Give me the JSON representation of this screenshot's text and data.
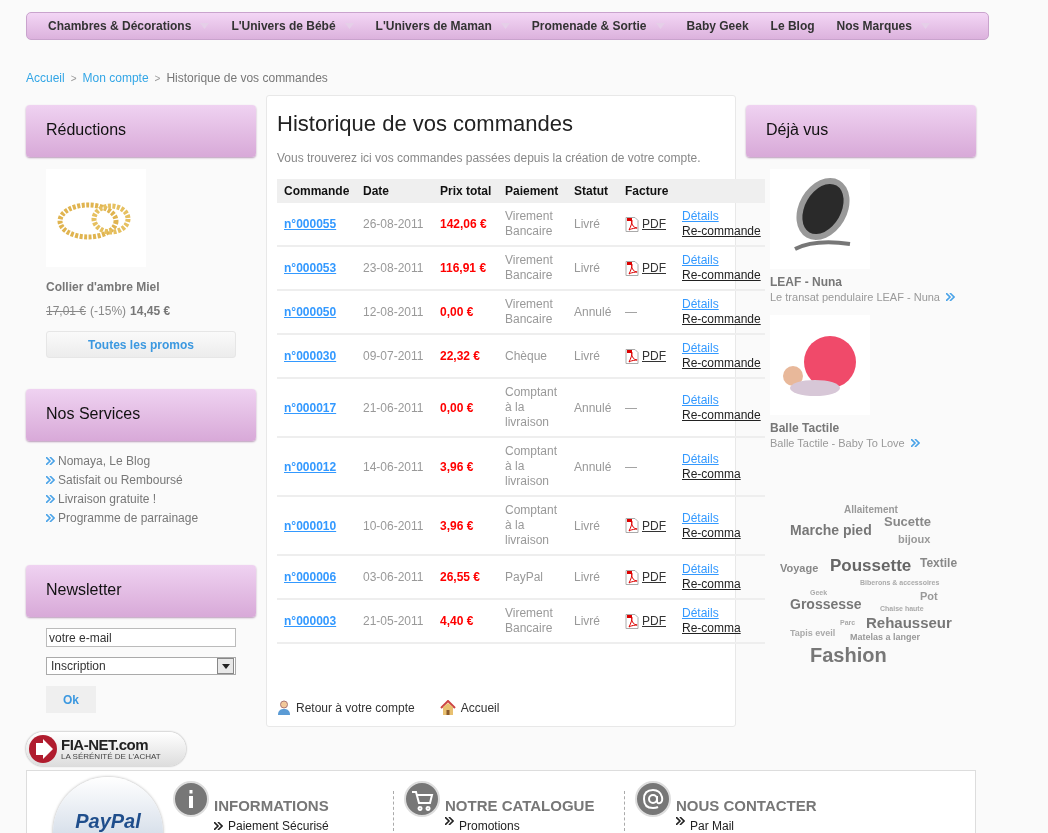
{
  "nav": [
    {
      "label": "Chambres & Décorations",
      "has_menu": true
    },
    {
      "label": "L'Univers de Bébé",
      "has_menu": true
    },
    {
      "label": "L'Univers de Maman",
      "has_menu": true
    },
    {
      "label": "Promenade & Sortie",
      "has_menu": true
    },
    {
      "label": "Baby Geek",
      "has_menu": false
    },
    {
      "label": "Le Blog",
      "has_menu": false
    },
    {
      "label": "Nos Marques",
      "has_menu": true
    }
  ],
  "breadcrumb": {
    "separator": ">",
    "links": [
      "Accueil",
      "Mon compte"
    ],
    "current": "Historique de vos commandes"
  },
  "left": {
    "reductions": {
      "title": "Réductions",
      "product": "Collier d'ambre Miel",
      "old_price": "17,01 €",
      "discount": "(-15%)",
      "price": "14,45 €",
      "button": "Toutes les promos"
    },
    "services": {
      "title": "Nos Services",
      "items": [
        "Nomaya, Le Blog",
        "Satisfait ou Remboursé",
        "Livraison gratuite !",
        "Programme de parrainage"
      ]
    },
    "newsletter": {
      "title": "Newsletter",
      "email": "votre e-mail",
      "select": "Inscription",
      "button": "Ok"
    }
  },
  "main": {
    "title": "Historique de vos commandes",
    "intro": "Vous trouverez ici vos commandes passées depuis la création de votre compte.",
    "table": {
      "columns": [
        "Commande",
        "Date",
        "Prix total",
        "Paiement",
        "Statut",
        "Facture"
      ],
      "rows": [
        {
          "order": "n°000055",
          "date": "26-08-2011",
          "total": "142,06 €",
          "payment": "Virement Bancaire",
          "status": "Livré",
          "invoice": "PDF",
          "pdf": true,
          "details": "Détails",
          "reorder": "Re-commande"
        },
        {
          "order": "n°000053",
          "date": "23-08-2011",
          "total": "116,91 €",
          "payment": "Virement Bancaire",
          "status": "Livré",
          "invoice": "PDF",
          "pdf": true,
          "details": "Détails",
          "reorder": "Re-commande"
        },
        {
          "order": "n°000050",
          "date": "12-08-2011",
          "total": "0,00 €",
          "payment": "Virement Bancaire",
          "status": "Annulé",
          "invoice": "—",
          "pdf": false,
          "details": "Détails",
          "reorder": "Re-commande"
        },
        {
          "order": "n°000030",
          "date": "09-07-2011",
          "total": "22,32 €",
          "payment": "Chèque",
          "status": "Livré",
          "invoice": "PDF",
          "pdf": true,
          "details": "Détails",
          "reorder": "Re-commande"
        },
        {
          "order": "n°000017",
          "date": "21-06-2011",
          "total": "0,00 €",
          "payment": "Comptant à la livraison",
          "status": "Annulé",
          "invoice": "—",
          "pdf": false,
          "details": "Détails",
          "reorder": "Re-commande"
        },
        {
          "order": "n°000012",
          "date": "14-06-2011",
          "total": "3,96 €",
          "payment": "Comptant à la livraison",
          "status": "Annulé",
          "invoice": "—",
          "pdf": false,
          "details": "Détails",
          "reorder": "Re-comma"
        },
        {
          "order": "n°000010",
          "date": "10-06-2011",
          "total": "3,96 €",
          "payment": "Comptant à la livraison",
          "status": "Livré",
          "invoice": "PDF",
          "pdf": true,
          "details": "Détails",
          "reorder": "Re-comma"
        },
        {
          "order": "n°000006",
          "date": "03-06-2011",
          "total": "26,55 €",
          "payment": "PayPal",
          "status": "Livré",
          "invoice": "PDF",
          "pdf": true,
          "details": "Détails",
          "reorder": "Re-comma"
        },
        {
          "order": "n°000003",
          "date": "21-05-2011",
          "total": "4,40 €",
          "payment": "Virement Bancaire",
          "status": "Livré",
          "invoice": "PDF",
          "pdf": true,
          "details": "Détails",
          "reorder": "Re-comma"
        }
      ]
    },
    "back": "Retour à votre compte",
    "home": "Accueil"
  },
  "right": {
    "title": "Déjà vus",
    "products": [
      {
        "name": "LEAF - Nuna",
        "desc": "Le transat pendulaire LEAF - Nuna"
      },
      {
        "name": "Balle Tactile",
        "desc": "Balle Tactile - Baby To Love"
      }
    ],
    "tags": [
      "Allaitement",
      "Sucette",
      "Marche pied",
      "bijoux",
      "Voyage",
      "Poussette",
      "Textile",
      "Biberons & accessoires",
      "Geek",
      "Grossesse",
      "Pot",
      "Chaise haute",
      "Rehausseur",
      "Parc",
      "Tapis eveil",
      "Matelas a langer",
      "Fashion"
    ]
  },
  "fianet": {
    "name": "FIA-NET.com",
    "tagline": "LA SÉRÉNITÉ DE L'ACHAT"
  },
  "footer": {
    "paypal": "PayPal",
    "columns": [
      {
        "kind": "info",
        "title": "INFORMATIONS",
        "link": "Paiement Sécurisé"
      },
      {
        "kind": "cart",
        "title": "NOTRE CATALOGUE",
        "link": "Promotions"
      },
      {
        "kind": "mail",
        "title": "NOUS CONTACTER",
        "link": "Par Mail"
      }
    ]
  }
}
